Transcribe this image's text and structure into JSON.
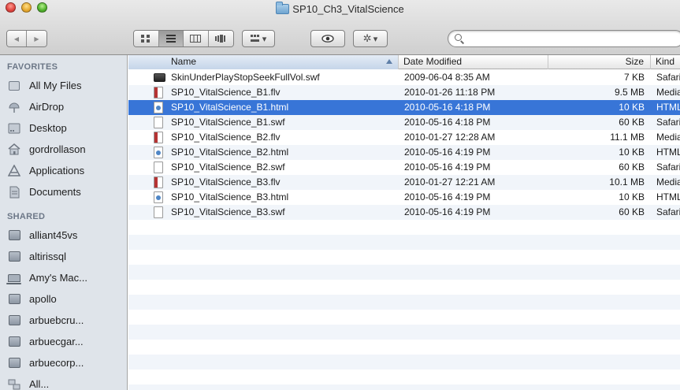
{
  "window": {
    "title": "SP10_Ch3_VitalScience"
  },
  "toolbar": {
    "back_glyph": "◀",
    "forward_glyph": "▶",
    "view_icons": [
      "icon-view-icon",
      "list-view-icon",
      "column-view-icon",
      "coverflow-view-icon"
    ],
    "arrange_glyph": "▾",
    "action_glyph": "▾",
    "search_placeholder": ""
  },
  "sidebar": {
    "favorites_header": "FAVORITES",
    "favorites": [
      {
        "label": "All My Files",
        "icon": "all-files-icon"
      },
      {
        "label": "AirDrop",
        "icon": "airdrop-icon"
      },
      {
        "label": "Desktop",
        "icon": "desktop-icon"
      },
      {
        "label": "gordrollason",
        "icon": "home-icon"
      },
      {
        "label": "Applications",
        "icon": "applications-icon"
      },
      {
        "label": "Documents",
        "icon": "documents-icon"
      }
    ],
    "shared_header": "SHARED",
    "shared": [
      {
        "label": "alliant45vs",
        "icon": "monitor-icon"
      },
      {
        "label": "altirissql",
        "icon": "monitor-icon"
      },
      {
        "label": "Amy's Mac...",
        "icon": "laptop-icon"
      },
      {
        "label": "apollo",
        "icon": "monitor-icon"
      },
      {
        "label": "arbuebcru...",
        "icon": "monitor-icon"
      },
      {
        "label": "arbuecgar...",
        "icon": "monitor-icon"
      },
      {
        "label": "arbuecorp...",
        "icon": "monitor-icon"
      },
      {
        "label": "All...",
        "icon": "network-icon"
      }
    ]
  },
  "columns": {
    "name": "Name",
    "date": "Date Modified",
    "size": "Size",
    "kind": "Kind"
  },
  "files": [
    {
      "name": "SkinUnderPlayStopSeekFullVol.swf",
      "date": "2009-06-04 8:35 AM",
      "size": "7 KB",
      "kind": "Safari",
      "type": "dark"
    },
    {
      "name": "SP10_VitalScience_B1.flv",
      "date": "2010-01-26 11:18 PM",
      "size": "9.5 MB",
      "kind": "Media",
      "type": "flv"
    },
    {
      "name": "SP10_VitalScience_B1.html",
      "date": "2010-05-16 4:18 PM",
      "size": "10 KB",
      "kind": "HTML",
      "type": "html",
      "selected": true
    },
    {
      "name": "SP10_VitalScience_B1.swf",
      "date": "2010-05-16 4:18 PM",
      "size": "60 KB",
      "kind": "Safari",
      "type": "swf"
    },
    {
      "name": "SP10_VitalScience_B2.flv",
      "date": "2010-01-27 12:28 AM",
      "size": "11.1 MB",
      "kind": "Media",
      "type": "flv"
    },
    {
      "name": "SP10_VitalScience_B2.html",
      "date": "2010-05-16 4:19 PM",
      "size": "10 KB",
      "kind": "HTML",
      "type": "html"
    },
    {
      "name": "SP10_VitalScience_B2.swf",
      "date": "2010-05-16 4:19 PM",
      "size": "60 KB",
      "kind": "Safari",
      "type": "swf"
    },
    {
      "name": "SP10_VitalScience_B3.flv",
      "date": "2010-01-27 12:21 AM",
      "size": "10.1 MB",
      "kind": "Media",
      "type": "flv"
    },
    {
      "name": "SP10_VitalScience_B3.html",
      "date": "2010-05-16 4:19 PM",
      "size": "10 KB",
      "kind": "HTML",
      "type": "html"
    },
    {
      "name": "SP10_VitalScience_B3.swf",
      "date": "2010-05-16 4:19 PM",
      "size": "60 KB",
      "kind": "Safari",
      "type": "swf"
    }
  ],
  "colors": {
    "selection": "#3875d7",
    "sidebar_bg": "#dfe4ea",
    "row_alt": "#f1f5fa"
  }
}
